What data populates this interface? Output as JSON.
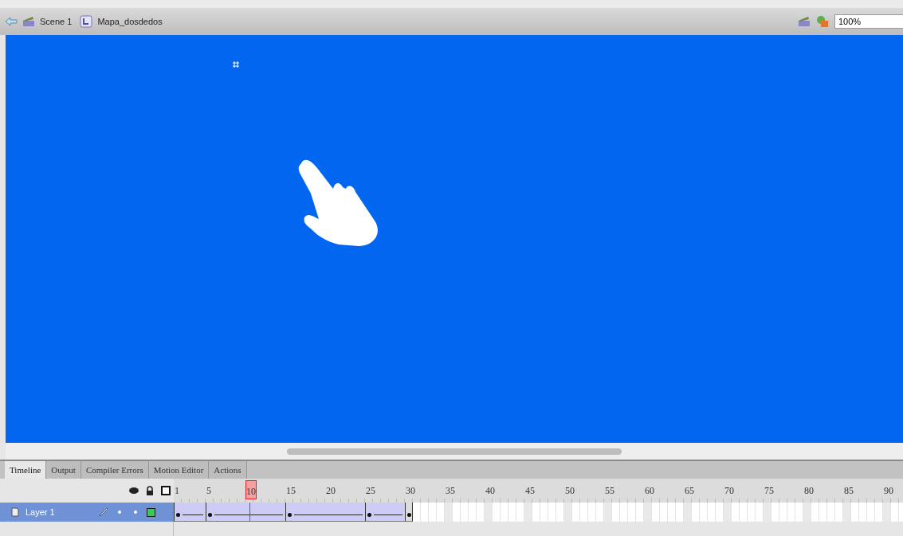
{
  "breadcrumb": [
    {
      "kind": "scene",
      "label": "Scene 1"
    },
    {
      "kind": "symbol",
      "label": "Mapa_dosdedos"
    }
  ],
  "zoom": {
    "value": "100%"
  },
  "tabs": [
    {
      "label": "Timeline",
      "selected": true
    },
    {
      "label": "Output",
      "selected": false
    },
    {
      "label": "Compiler Errors",
      "selected": false
    },
    {
      "label": "Motion Editor",
      "selected": false
    },
    {
      "label": "Actions",
      "selected": false
    }
  ],
  "ruler": [
    {
      "label": "1",
      "selected": false
    },
    {
      "label": "5",
      "selected": false
    },
    {
      "label": "10",
      "selected": true
    },
    {
      "label": "15",
      "selected": false
    },
    {
      "label": "20",
      "selected": false
    },
    {
      "label": "25",
      "selected": false
    },
    {
      "label": "30",
      "selected": false
    },
    {
      "label": "35",
      "selected": false
    },
    {
      "label": "40",
      "selected": false
    },
    {
      "label": "45",
      "selected": false
    },
    {
      "label": "50",
      "selected": false
    },
    {
      "label": "55",
      "selected": false
    },
    {
      "label": "60",
      "selected": false
    },
    {
      "label": "65",
      "selected": false
    },
    {
      "label": "70",
      "selected": false
    },
    {
      "label": "75",
      "selected": false
    },
    {
      "label": "80",
      "selected": false
    },
    {
      "label": "85",
      "selected": false
    },
    {
      "label": "90",
      "selected": false
    }
  ],
  "layer": {
    "name": "Layer 1",
    "selected": true,
    "color": "#33cc55",
    "frames": [
      {
        "kind": "key"
      },
      {
        "kind": "tween"
      },
      {
        "kind": "tween"
      },
      {
        "kind": "tween"
      },
      {
        "kind": "key"
      },
      {
        "kind": "tween"
      },
      {
        "kind": "tween"
      },
      {
        "kind": "tween"
      },
      {
        "kind": "tween"
      },
      {
        "kind": "tween"
      },
      {
        "kind": "tween"
      },
      {
        "kind": "tween"
      },
      {
        "kind": "tween"
      },
      {
        "kind": "tween"
      },
      {
        "kind": "key"
      },
      {
        "kind": "tween"
      },
      {
        "kind": "tween"
      },
      {
        "kind": "tween"
      },
      {
        "kind": "tween"
      },
      {
        "kind": "tween"
      },
      {
        "kind": "tween"
      },
      {
        "kind": "tween"
      },
      {
        "kind": "tween"
      },
      {
        "kind": "tween"
      },
      {
        "kind": "key"
      },
      {
        "kind": "tween"
      },
      {
        "kind": "tween"
      },
      {
        "kind": "tween"
      },
      {
        "kind": "tween"
      },
      {
        "kind": "end"
      }
    ]
  }
}
